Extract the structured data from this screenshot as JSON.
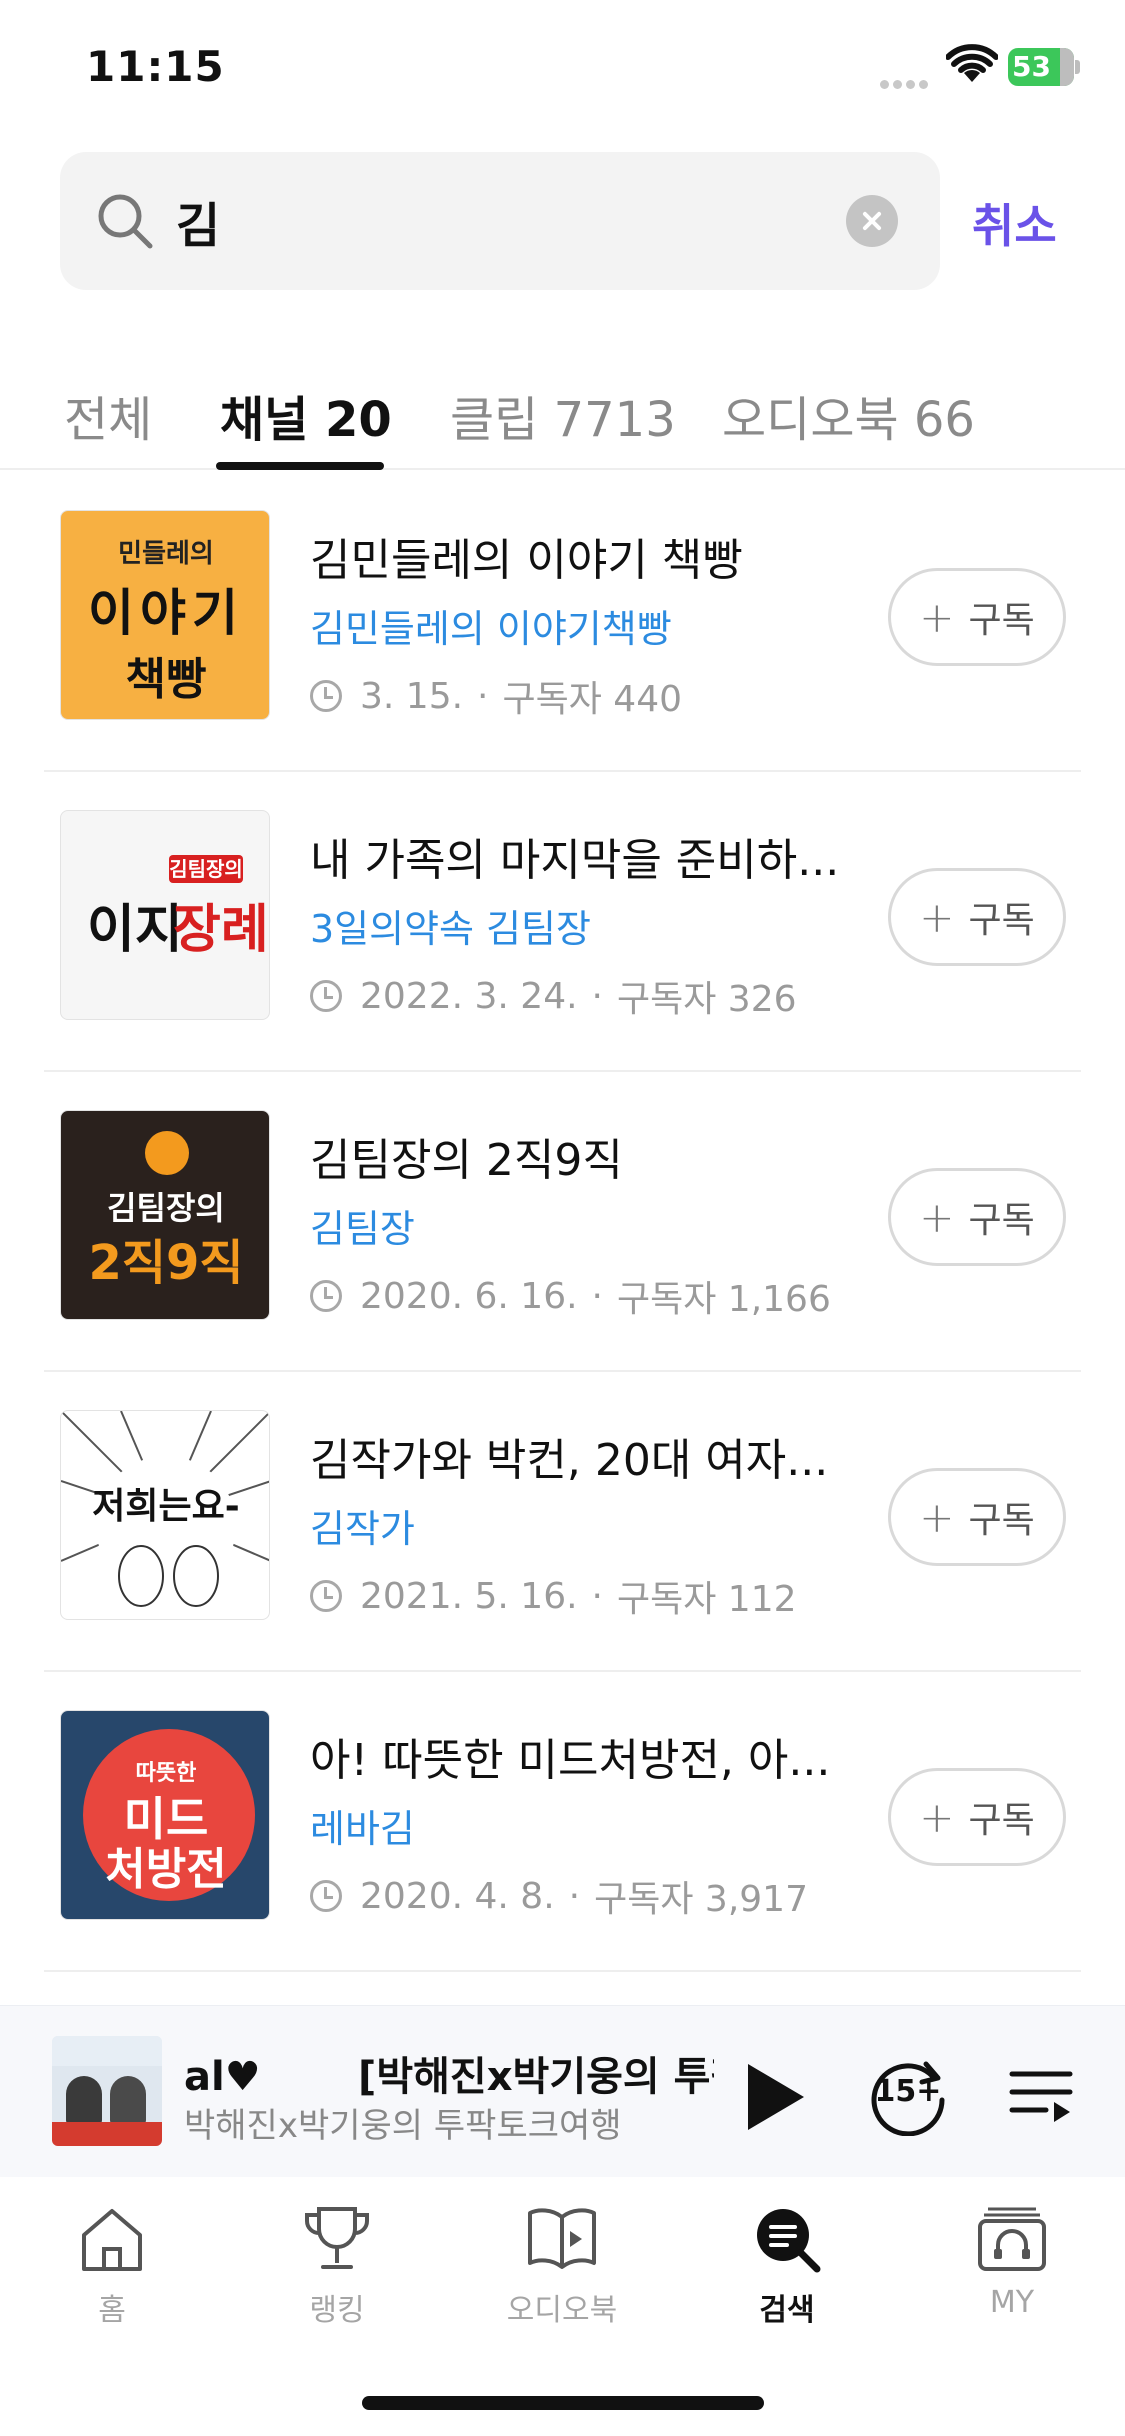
{
  "status_bar": {
    "time": "11:15",
    "battery": "53"
  },
  "search": {
    "query": "김",
    "cancel_label": "취소"
  },
  "tabs": [
    {
      "label": "전체",
      "active": false
    },
    {
      "label": "채널 20",
      "active": true
    },
    {
      "label": "클립 7713",
      "active": false
    },
    {
      "label": "오디오북 66",
      "active": false
    }
  ],
  "channels": [
    {
      "title": "김민들레의 이야기 책빵",
      "author": "김민들레의 이야기책빵",
      "date": "3. 15.",
      "subscribers": "구독자 440",
      "subscribe_label": "구독",
      "thumb": {
        "line1": "민들레의",
        "line2": "이야기",
        "line3": "책빵"
      }
    },
    {
      "title": "내 가족의 마지막을 준비하...",
      "author": "3일의약속 김팀장",
      "date": "2022. 3. 24.",
      "subscribers": "구독자 326",
      "subscribe_label": "구독",
      "thumb": {
        "line1": "김팀장의",
        "line2": "이지",
        "line3": "장례"
      }
    },
    {
      "title": "김팀장의 2직9직",
      "author": "김팀장",
      "date": "2020. 6. 16.",
      "subscribers": "구독자 1,166",
      "subscribe_label": "구독",
      "thumb": {
        "line1": "김팀장의",
        "line2": "2직9직"
      }
    },
    {
      "title": "김작가와 박컨, 20대 여자...",
      "author": "김작가",
      "date": "2021. 5. 16.",
      "subscribers": "구독자 112",
      "subscribe_label": "구독",
      "thumb": {
        "line1": "저희는요-"
      }
    },
    {
      "title": "아! 따뜻한 미드처방전, 아...",
      "author": "레바김",
      "date": "2020. 4. 8.",
      "subscribers": "구독자 3,917",
      "subscribe_label": "구독",
      "thumb": {
        "line1": "따뜻한",
        "line2": "미드",
        "line3": "처방전"
      }
    }
  ],
  "player": {
    "title": "[박해진x박기웅의 투팍",
    "title_prefix": "al♥",
    "subtitle": "박해진x박기웅의 투팍토크여행",
    "skip_label": "15"
  },
  "nav": [
    {
      "label": "홈",
      "icon": "home-icon",
      "active": false
    },
    {
      "label": "랭킹",
      "icon": "trophy-icon",
      "active": false
    },
    {
      "label": "오디오북",
      "icon": "audiobook-icon",
      "active": false
    },
    {
      "label": "검색",
      "icon": "search-icon",
      "active": true
    },
    {
      "label": "MY",
      "icon": "my-icon",
      "active": false
    }
  ],
  "colors": {
    "accent": "#6a52e8",
    "author": "#2c8be0",
    "battery": "#3cc75a"
  }
}
